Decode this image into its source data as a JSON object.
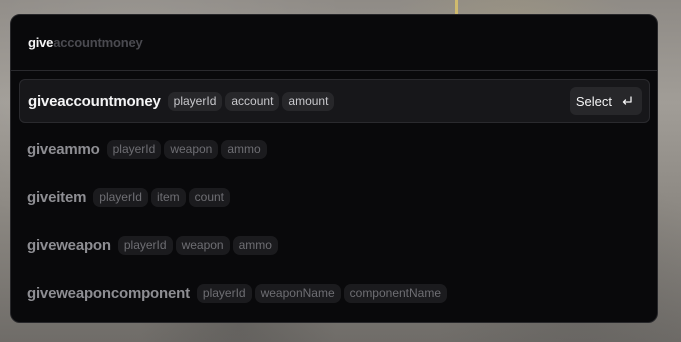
{
  "search": {
    "typed": "give",
    "suggestion": "accountmoney"
  },
  "commands": [
    {
      "name": "giveaccountmoney",
      "params": [
        "playerId",
        "account",
        "amount"
      ],
      "selected": true
    },
    {
      "name": "giveammo",
      "params": [
        "playerId",
        "weapon",
        "ammo"
      ],
      "selected": false
    },
    {
      "name": "giveitem",
      "params": [
        "playerId",
        "item",
        "count"
      ],
      "selected": false
    },
    {
      "name": "giveweapon",
      "params": [
        "playerId",
        "weapon",
        "ammo"
      ],
      "selected": false
    },
    {
      "name": "giveweaponcomponent",
      "params": [
        "playerId",
        "weaponName",
        "componentName"
      ],
      "selected": false
    }
  ],
  "select_button": {
    "label": "Select",
    "icon": "enter-icon"
  },
  "colors": {
    "panel_bg": "#09090b",
    "active_row_bg": "#17171a",
    "text_primary": "#f4f4f5",
    "text_muted": "#8e8e93"
  }
}
